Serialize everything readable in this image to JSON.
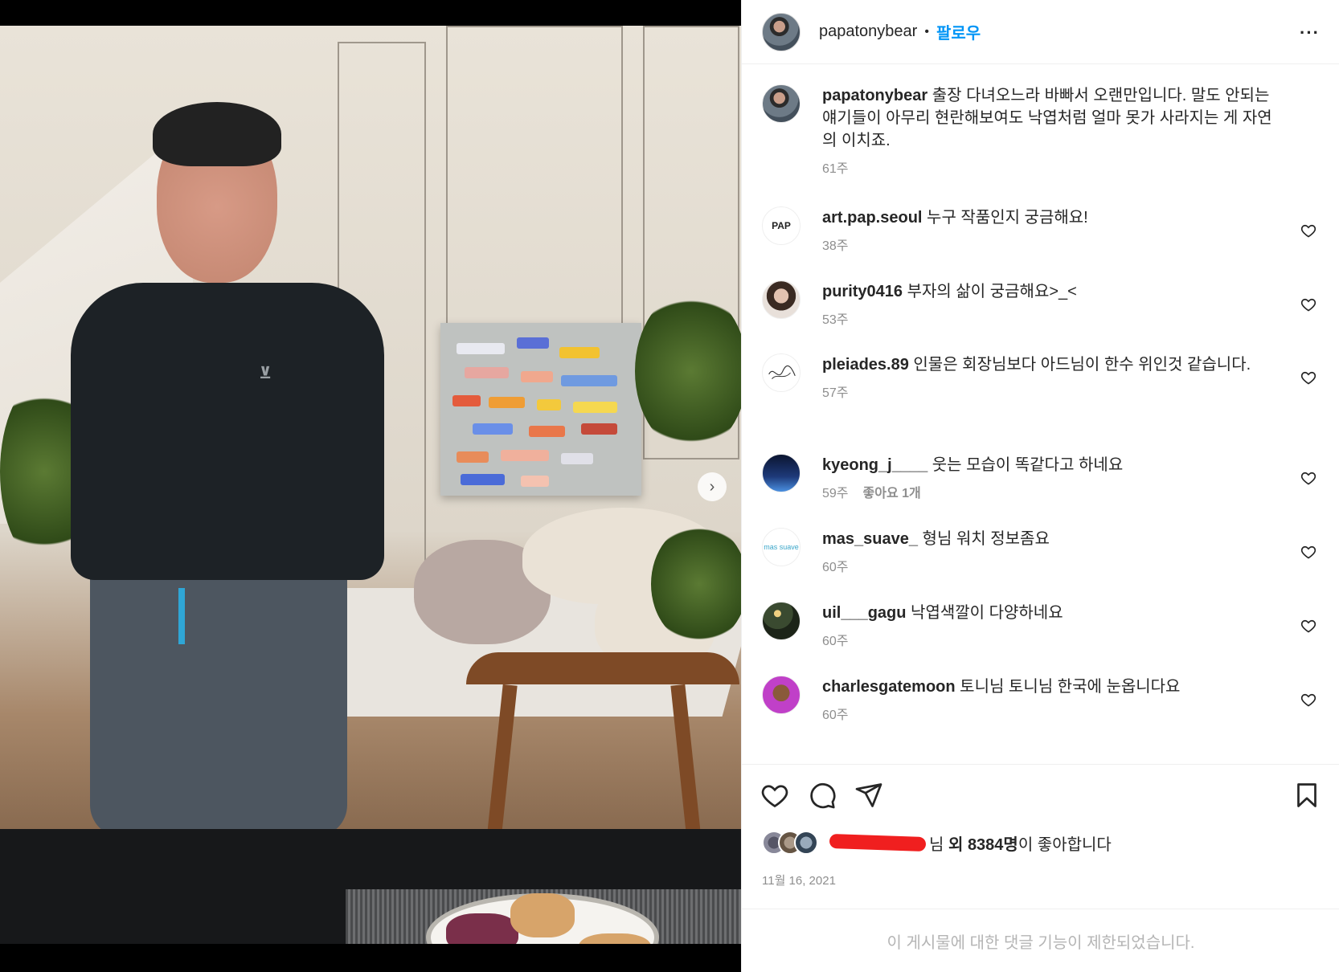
{
  "post": {
    "username": "papatonybear",
    "follow_label": "팔로우",
    "caption": "출장 다녀오느라 바빠서 오랜만입니다. 말도 안되는 얘기들이 아무리 현란해보여도 낙엽처럼 얼마 못가 사라지는 게 자연의 이치죠.",
    "caption_time": "61주"
  },
  "comments": [
    {
      "username": "art.pap.seoul",
      "text": "누구 작품인지 궁금해요!",
      "time": "38주",
      "likes": ""
    },
    {
      "username": "purity0416",
      "text": "부자의 삶이 궁금해요>_<",
      "time": "53주",
      "likes": ""
    },
    {
      "username": "pleiades.89",
      "text": "인물은 회장님보다 아드님이 한수 위인것 같습니다.",
      "time": "57주",
      "likes": ""
    },
    {
      "username": "kyeong_j____",
      "text": "웃는 모습이 똑같다고 하네요",
      "time": "59주",
      "likes": "좋아요 1개"
    },
    {
      "username": "mas_suave_",
      "text": "형님 워치 정보좀요",
      "time": "60주",
      "likes": ""
    },
    {
      "username": "uil___gagu",
      "text": "낙엽색깔이 다양하네요",
      "time": "60주",
      "likes": ""
    },
    {
      "username": "charlesgatemoon",
      "text": "토니님 토니님 한국에 눈옵니다요",
      "time": "60주",
      "likes": ""
    }
  ],
  "avatar_labels": {
    "art_pap": "PAP",
    "mas_suave": "mas suave"
  },
  "likes": {
    "suffix_name": "님",
    "and_others": "외",
    "count": "8384명",
    "tail": "이 좋아합니다"
  },
  "date": "11월 16, 2021",
  "footer_notice": "이 게시물에 대한 댓글 기능이 제한되었습니다.",
  "colors": {
    "accent": "#0095f6",
    "secondary_text": "#8e8e8e",
    "redaction": "#f01f1f"
  },
  "icons": {
    "more": "more-options-icon",
    "like": "heart-icon",
    "comment": "comment-icon",
    "share": "send-icon",
    "save": "bookmark-icon",
    "next": "chevron-right-icon"
  }
}
